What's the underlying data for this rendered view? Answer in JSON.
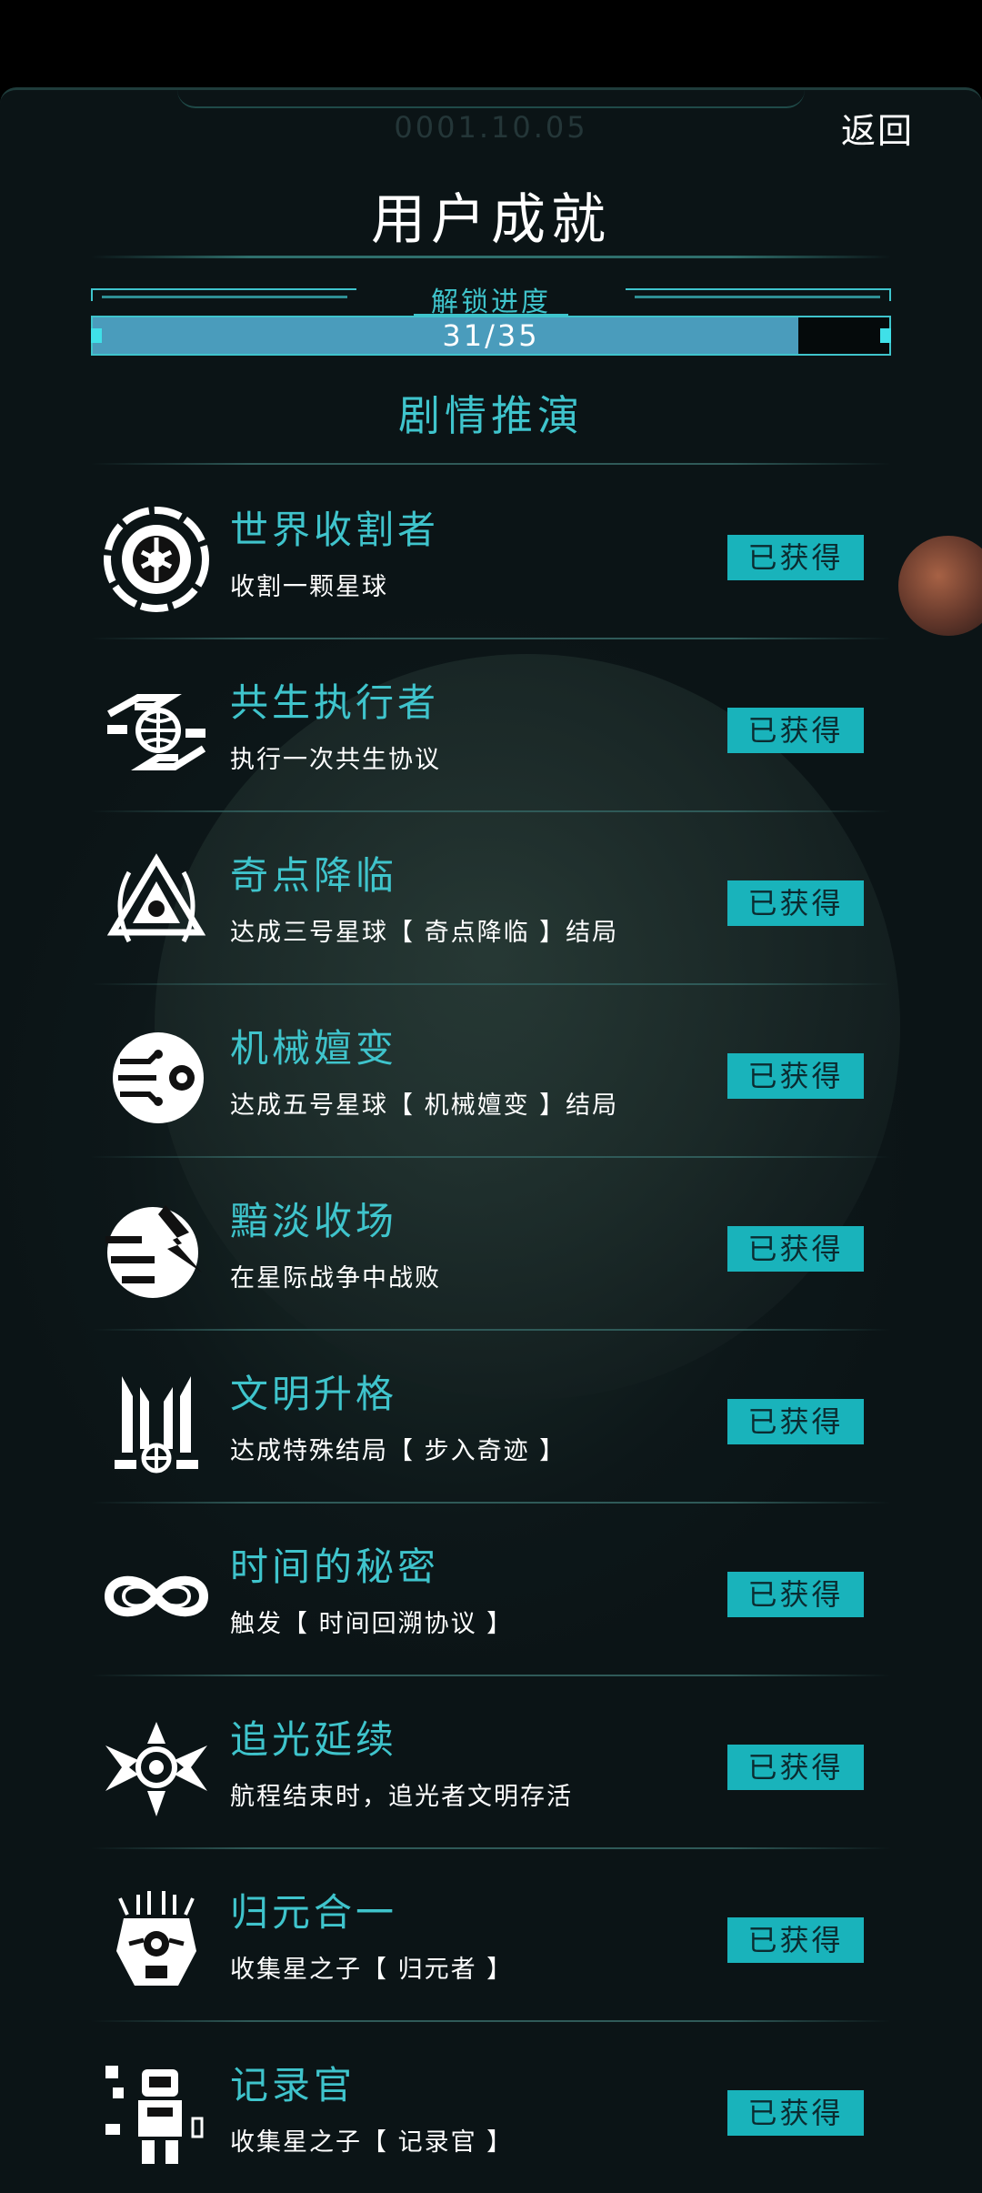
{
  "header": {
    "date": "0001.10.05",
    "back_label": "返回",
    "title": "用户成就"
  },
  "progress": {
    "label": "解锁进度",
    "text": "31/35",
    "unlocked": 31,
    "total": 35
  },
  "section_title": "剧情推演",
  "achievements": [
    {
      "icon": "world-harvester-icon",
      "name": "世界收割者",
      "desc": "收割一颗星球",
      "status": "已获得"
    },
    {
      "icon": "symbiosis-executor-icon",
      "name": "共生执行者",
      "desc": "执行一次共生协议",
      "status": "已获得"
    },
    {
      "icon": "singularity-icon",
      "name": "奇点降临",
      "desc": "达成三号星球【 奇点降临 】结局",
      "status": "已获得"
    },
    {
      "icon": "mechanical-evolution-icon",
      "name": "机械嬗变",
      "desc": "达成五号星球【 机械嬗变 】结局",
      "status": "已获得"
    },
    {
      "icon": "bleak-end-icon",
      "name": "黯淡收场",
      "desc": "在星际战争中战败",
      "status": "已获得"
    },
    {
      "icon": "civilization-ascension-icon",
      "name": "文明升格",
      "desc": "达成特殊结局【 步入奇迹 】",
      "status": "已获得"
    },
    {
      "icon": "infinity-icon",
      "name": "时间的秘密",
      "desc": "触发【 时间回溯协议 】",
      "status": "已获得"
    },
    {
      "icon": "light-chaser-icon",
      "name": "追光延续",
      "desc": "航程结束时，追光者文明存活",
      "status": "已获得"
    },
    {
      "icon": "unifier-mask-icon",
      "name": "归元合一",
      "desc": "收集星之子【 归元者 】",
      "status": "已获得"
    },
    {
      "icon": "recorder-robot-icon",
      "name": "记录官",
      "desc": "收集星之子【 记录官 】",
      "status": "已获得"
    }
  ]
}
